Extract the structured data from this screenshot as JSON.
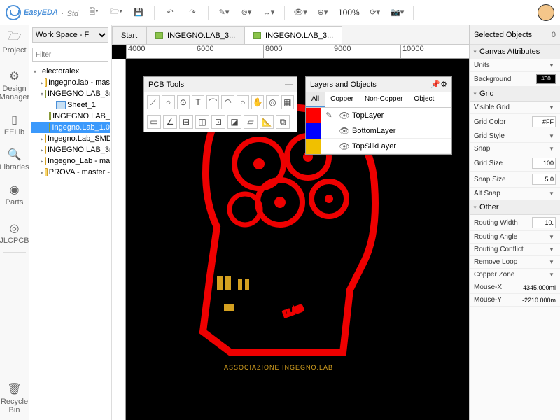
{
  "app": {
    "name": "EasyEDA",
    "edition": "Std"
  },
  "toolbar": {
    "zoom": "100%"
  },
  "leftbar": [
    {
      "icon": "🗁",
      "label": "Project"
    },
    {
      "icon": "⚙",
      "label": "Design Manager"
    },
    {
      "icon": "▯",
      "label": "EELib"
    },
    {
      "icon": "🔍",
      "label": "Libraries"
    },
    {
      "icon": "◉",
      "label": "Parts"
    },
    {
      "icon": "◎",
      "label": "JLCPCB"
    },
    {
      "icon": "🗑",
      "label": "Recycle Bin"
    }
  ],
  "workspace": {
    "selected": "Work Space - F",
    "filter_placeholder": "Filter"
  },
  "tree": {
    "root": "electoralex",
    "items": [
      {
        "icon": "folder",
        "label": "Ingegno.lab - mas",
        "indent": 1,
        "arrow": "▸"
      },
      {
        "icon": "folder-g",
        "label": "INGEGNO.LAB_3r",
        "indent": 1,
        "arrow": "▾"
      },
      {
        "icon": "sheet",
        "label": "Sheet_1",
        "indent": 2,
        "arrow": ""
      },
      {
        "icon": "folder-g",
        "label": "INGEGNO.LAB_",
        "indent": 2,
        "arrow": ""
      },
      {
        "icon": "folder-g",
        "label": "Ingegno.Lab_1.0",
        "indent": 2,
        "arrow": "",
        "sel": true
      },
      {
        "icon": "folder",
        "label": "Ingegno.Lab_SMD",
        "indent": 1,
        "arrow": "▸"
      },
      {
        "icon": "folder",
        "label": "INGEGNO.LAB_3r",
        "indent": 1,
        "arrow": "▸"
      },
      {
        "icon": "folder",
        "label": "Ingegno_Lab - ma",
        "indent": 1,
        "arrow": "▸"
      },
      {
        "icon": "folder",
        "label": "PROVA - master -",
        "indent": 1,
        "arrow": "▸"
      }
    ]
  },
  "tabs": [
    {
      "label": "Start",
      "icon": false
    },
    {
      "label": "INGEGNO.LAB_3...",
      "icon": true
    },
    {
      "label": "INGEGNO.LAB_3...",
      "icon": true,
      "active": true
    }
  ],
  "ruler": [
    "4000",
    "6000",
    "8000",
    "9000",
    "10000"
  ],
  "pcb_tools": {
    "title": "PCB Tools"
  },
  "layers": {
    "title": "Layers and Objects",
    "tabs": [
      "All",
      "Copper",
      "Non-Copper",
      "Object"
    ],
    "active": "All",
    "rows": [
      {
        "color": "#ff0000",
        "name": "TopLayer",
        "pen": true
      },
      {
        "color": "#0000ff",
        "name": "BottomLayer"
      },
      {
        "color": "#f0c000",
        "name": "TopSilkLayer"
      }
    ]
  },
  "silk_text": "ASSOCIAZIONE INGEGNO.LAB",
  "right": {
    "selected": {
      "label": "Selected Objects",
      "count": "0"
    },
    "sections": [
      {
        "title": "Canvas Attributes",
        "rows": [
          {
            "label": "Units",
            "type": "dd"
          },
          {
            "label": "Background",
            "type": "sw",
            "val": "#00"
          }
        ]
      },
      {
        "title": "Grid",
        "rows": [
          {
            "label": "Visible Grid",
            "type": "dd"
          },
          {
            "label": "Grid Color",
            "type": "val",
            "val": "#FF"
          },
          {
            "label": "Grid Style",
            "type": "dd"
          },
          {
            "label": "Snap",
            "type": "dd"
          },
          {
            "label": "Grid Size",
            "type": "val",
            "val": "100"
          },
          {
            "label": "Snap Size",
            "type": "val",
            "val": "5.0"
          },
          {
            "label": "Alt Snap",
            "type": "dd"
          }
        ]
      },
      {
        "title": "Other",
        "rows": [
          {
            "label": "Routing Width",
            "type": "val",
            "val": "10."
          },
          {
            "label": "Routing Angle",
            "type": "dd"
          },
          {
            "label": "Routing Conflict",
            "type": "dd"
          },
          {
            "label": "Remove Loop",
            "type": "dd"
          },
          {
            "label": "Copper Zone",
            "type": "dd"
          }
        ]
      }
    ],
    "status": [
      {
        "label": "Mouse-X",
        "val": "4345.000mi"
      },
      {
        "label": "Mouse-Y",
        "val": "-2210.000m"
      }
    ]
  }
}
